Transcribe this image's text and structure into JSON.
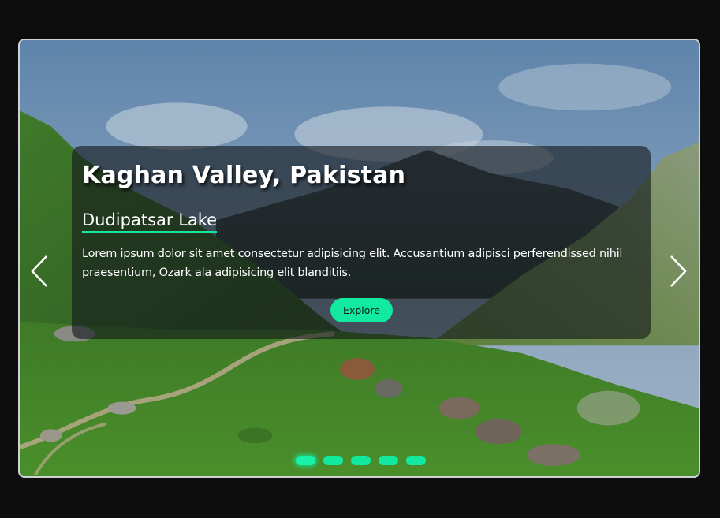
{
  "slide": {
    "title": "Kaghan Valley, Pakistan",
    "subtitle": "Dudipatsar Lake",
    "description": "Lorem ipsum dolor sit amet consectetur adipisicing elit. Accusantium adipisci perferendissed nihil praesentium, Ozark ala adipisicing elit blanditiis.",
    "button_label": "Explore"
  },
  "navigation": {
    "prev_icon": "chevron-left-icon",
    "next_icon": "chevron-right-icon"
  },
  "pagination": {
    "total": 5,
    "active_index": 0
  },
  "colors": {
    "accent": "#12e8a0",
    "page_background": "#0d0d0d",
    "overlay": "rgba(20,24,28,0.62)",
    "frame_border": "#cfd3d6"
  }
}
